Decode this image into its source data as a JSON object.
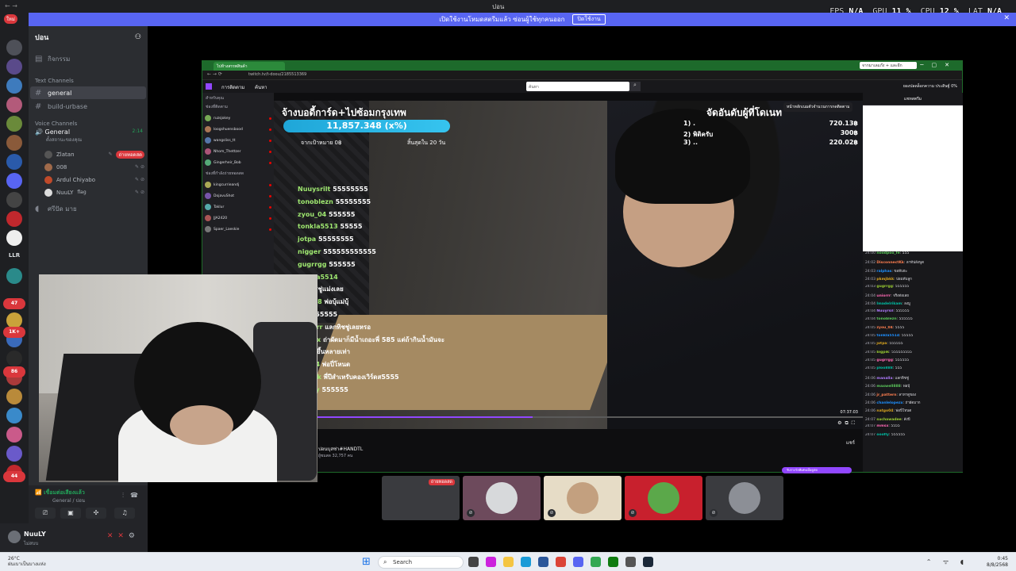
{
  "overlay_stats": {
    "fps_label": "FPS",
    "fps": "N/A",
    "gpu_label": "GPU",
    "gpu": "11 %",
    "cpu_label": "CPU",
    "cpu": "12 %",
    "lat_label": "LAT",
    "lat": "N/A"
  },
  "window": {
    "title": "ปอน"
  },
  "banner": {
    "text": "เปิดใช้งานโหมดสตรีมแล้ว ซ่อนผู้ใช้ทุกคนออก",
    "button": "ปิดใช้งาน"
  },
  "rail": {
    "new_badge": "ใหม่",
    "label_llr": "LLR",
    "badges": [
      "47",
      "31",
      "1K+",
      "1K+",
      "86",
      "23",
      "1K+",
      "44"
    ]
  },
  "sidebar": {
    "server_name": "ปอน",
    "activity": "กิจกรรม",
    "text_category": "Text Channels",
    "text_channels": [
      "general",
      "build-urbase"
    ],
    "voice_category": "Voice Channels",
    "voice_channel": {
      "name": "General",
      "sub": "ตั้งสถานะของคุณ",
      "timer": "2:14"
    },
    "voice_users": [
      {
        "name": "Zlatan",
        "live": "ถ่ายทอดสด"
      },
      {
        "name": "008"
      },
      {
        "name": "Ardul Chiyabo"
      },
      {
        "name": "NuuLY",
        "tag": "flag"
      }
    ],
    "other_voice": "ศรีปัด มาย"
  },
  "voice_panel": {
    "status": "เชื่อมต่อเสียงแล้ว",
    "channel": "General / ปอน"
  },
  "user_panel": {
    "name": "NuuLY",
    "status": "ไม่สบบ"
  },
  "browser": {
    "tab_title": "ไปห้างสรรพสินค้า",
    "popup": "จากมาเลแก๊ง + และอีก",
    "address": "twitch.tv/t-doou/2185513369",
    "twitch_nav": [
      "การติดตาม",
      "ค้นหา"
    ],
    "search_placeholder": "ค้นหา",
    "twitch_right": "ยองปลดล็อกความ  ประดิษฐ์  0%",
    "left_nav_title": "สำหรับคุณ",
    "left_nav_sub": "ช่องที่ติดตาม",
    "left_nav_items": [
      "ruzsjokey",
      "loogshuensbood",
      "wangsliss_tt",
      "Nhom_Thettzer",
      "Gingerheir_Bob",
      "kingcurrieandj",
      "DojavuShot",
      "Taklur",
      "JJA2420",
      "Spaer_Laeskie"
    ],
    "left_nav_sub2": "ช่องที่กำลังถ่ายทอดสด"
  },
  "stream_overlay": {
    "goal_title": "จ้างบอดี้การ์ด+ไปซ้อมกรุงเทพ",
    "goal_amount": "11,857.348 (x%)",
    "goal_left": "จากเป้าหมาย 0฿",
    "goal_right": "สิ้นสุดใน 20 วัน",
    "rank_title": "จัดอันดับผู้ที่โดเนท",
    "rank_popup": "หน้าหลักเนมตัวจำนวนการกดติดตาม",
    "rank_list": [
      {
        "label": "1) .",
        "value": "720.13฿"
      },
      {
        "label": "2) พิติครับ",
        "value": "300฿"
      },
      {
        "label": "3) ..",
        "value": "220.02฿"
      }
    ],
    "chat": [
      {
        "name": "Nuuysrilt",
        "msg": "55555555"
      },
      {
        "name": "tonoblezn",
        "msg": "55555555"
      },
      {
        "name": "zyou_04",
        "msg": "555555"
      },
      {
        "name": "tonkla5513",
        "msg": "55555"
      },
      {
        "name": "jotpa",
        "msg": "55555555"
      },
      {
        "name": "nigger",
        "msg": "555555555555"
      },
      {
        "name": "gugrrgg",
        "msg": "555555"
      },
      {
        "name": "tonkla5514",
        "msg": ""
      },
      {
        "name": "",
        "msg": "แลกทิชชู่แม่งเลย"
      },
      {
        "name": "plo888",
        "msg": "พ่อบุ้แม่บุ้"
      },
      {
        "name": "",
        "msg": "555555555"
      },
      {
        "name": "uniorrr",
        "msg": "แลกทิชชู่เลยหรอ"
      },
      {
        "name": "lopezx",
        "msg": "ถ่าผัดมาก็มีน้ำเถอะพี่ 585 แต่ถ้ากินน้ำมันจะ"
      },
      {
        "name": "",
        "msg": "เพิ่มน้ำขึ้นหลายเท่า"
      },
      {
        "name": "hoh04",
        "msg": "พ่อปี่โหนด"
      },
      {
        "name": "rgtvdk",
        "msg": "พี่ปีสำเหรับคองเวิร์ดส5555"
      },
      {
        "name": "ooofly",
        "msg": "555555"
      }
    ],
    "time": "07:37:03",
    "progress": 0.44
  },
  "stream_info": {
    "channel": "ปอนบุสซ่า#HANDTL",
    "viewers": "ผู้ชมสด 32,757 คน",
    "share": "แชร์",
    "promo": "รับรางวัลพิเศษเมื่อดูสด"
  },
  "twitch_chat": {
    "header": "แชทสตรีม",
    "lines": [
      {
        "time": "24:00",
        "user": "noodpoo_fe",
        "msg": "555"
      },
      {
        "time": "24:02",
        "user": "DisconnectKk",
        "msg": "ลาทัน่ลังพูด"
      },
      {
        "time": "24:03",
        "user": "ralphas",
        "msg": "ขอทับฮะ"
      },
      {
        "time": "24:03",
        "user": "pkmjbkk",
        "msg": "ปอมทับลูก"
      },
      {
        "time": "24:03",
        "user": "gugrrgg",
        "msg": "555555"
      },
      {
        "time": "24:04",
        "user": "uniorrr",
        "msg": "จริงต่อเลย"
      },
      {
        "time": "24:04",
        "user": "Imadelrikam",
        "msg": "ลงมู"
      },
      {
        "time": "24:04",
        "user": "Nuuyrsil",
        "msg": "555555"
      },
      {
        "time": "24:04",
        "user": "tonoblezn",
        "msg": "555555"
      },
      {
        "time": "24:05",
        "user": "zyou_04",
        "msg": "5555"
      },
      {
        "time": "24:05",
        "user": "tonkla5514",
        "msg": "55555"
      },
      {
        "time": "24:05",
        "user": "jotpa",
        "msg": "555555"
      },
      {
        "time": "24:05",
        "user": "bigpik",
        "msg": "555555555"
      },
      {
        "time": "24:05",
        "user": "gugrrgg",
        "msg": "555555"
      },
      {
        "time": "24:05",
        "user": "ploo888",
        "msg": "555"
      },
      {
        "time": "24:06",
        "user": "manalla",
        "msg": "แลกทิชชู่"
      },
      {
        "time": "24:06",
        "user": "maxwell888",
        "msg": "พ่อบุ้"
      },
      {
        "time": "24:06",
        "user": "jr_pattern",
        "msg": "ลาทาดูของ"
      },
      {
        "time": "24:06",
        "user": "chanlelopezx",
        "msg": "ถ่าผัดมาก"
      },
      {
        "time": "24:06",
        "user": "natgo04",
        "msg": "พ่อปี่โหนด"
      },
      {
        "time": "24:07",
        "user": "suchawadee",
        "msg": "ลังปี"
      },
      {
        "time": "24:07",
        "user": "mmsx",
        "msg": "5555"
      },
      {
        "time": "24:07",
        "user": "ooofly",
        "msg": "555555"
      }
    ]
  },
  "participants": [
    {
      "name": "Zlatan",
      "live": "ถ่ายทอดสด",
      "bg": "#3a3b3f"
    },
    {
      "name": "008",
      "bg": "#6d4a5c"
    },
    {
      "name": "Ardul Chiyabo",
      "bg": "#e6dcc6"
    },
    {
      "name": "NuuLY",
      "bg": "#c8202d"
    },
    {
      "name": "Other",
      "bg": "#3a3b3f"
    }
  ],
  "taskbar": {
    "weather_temp": "26°C",
    "weather_desc": "ฝนเบาเป็นบางแห่ง",
    "search": "Search",
    "time": "0:45",
    "date": "8/8/2568"
  }
}
